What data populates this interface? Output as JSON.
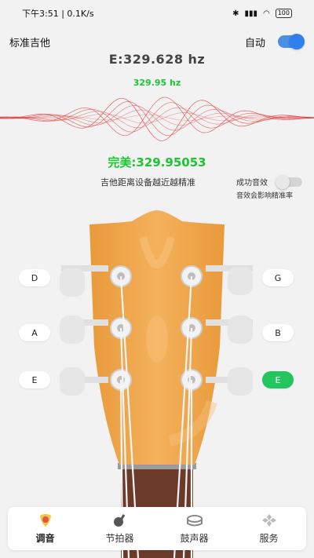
{
  "status_bar": {
    "time": "下午3:51 | 0.1K/s",
    "battery": "100"
  },
  "header": {
    "tuning_mode": "标准吉他",
    "auto_label": "自动",
    "auto_on": true
  },
  "tuner": {
    "target_freq": "E:329.628  hz",
    "detected_freq": "329.95 hz",
    "status": "完美:329.95053",
    "hint": "吉他距离设备越近越精准",
    "sound_effect_label": "成功音效",
    "sound_effect_note": "音效会影响精准率",
    "sound_effect_on": false
  },
  "strings": {
    "left": [
      {
        "note": "D"
      },
      {
        "note": "A"
      },
      {
        "note": "E"
      }
    ],
    "right": [
      {
        "note": "G"
      },
      {
        "note": "B"
      },
      {
        "note": "E",
        "active": true
      }
    ]
  },
  "colors": {
    "accent_green": "#1cc62f",
    "toggle_blue": "#2f80ed",
    "headstock": "#f0a94e",
    "wave_red": "#e23b3b"
  },
  "bottom_nav": [
    {
      "label": "调音",
      "icon": "guitar-pick-icon",
      "active": true
    },
    {
      "label": "节拍器",
      "icon": "metronome-icon"
    },
    {
      "label": "鼓声器",
      "icon": "drum-icon"
    },
    {
      "label": "服务",
      "icon": "service-icon"
    }
  ]
}
